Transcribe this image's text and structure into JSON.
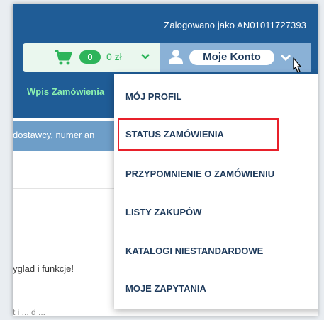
{
  "header": {
    "login_text": "Zalogowano jako AN01011727393"
  },
  "cart": {
    "count": "0",
    "amount": "0 zł",
    "icon": "cart-icon"
  },
  "account": {
    "label": "Moje Konto",
    "icon": "user-icon"
  },
  "nav": {
    "link": "Wpis Zamówienia"
  },
  "search": {
    "text": "dostawcy, numer an"
  },
  "content": {
    "line1": "yglad i funkcje!",
    "line2": "t i ... d ..."
  },
  "dropdown": {
    "items": [
      {
        "label": "MÓJ PROFIL"
      },
      {
        "label": "STATUS ZAMÓWIENIA"
      },
      {
        "label": "PRZYPOMNIENIE O ZAMÓWIENIU"
      },
      {
        "label": "LISTY ZAKUPÓW"
      },
      {
        "label": "KATALOGI NIESTANDARDOWE"
      },
      {
        "label": "MOJE ZAPYTANIA"
      }
    ]
  },
  "colors": {
    "header_bg": "#1f5c96",
    "cart_green": "#2db45a",
    "highlight_red": "#e8202a"
  }
}
